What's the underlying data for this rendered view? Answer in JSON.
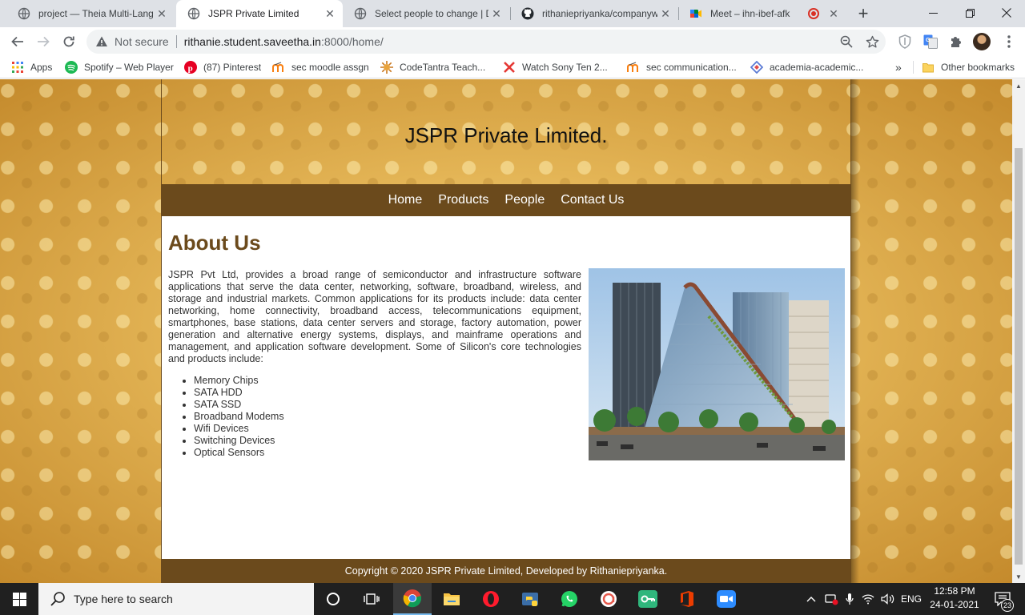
{
  "browser": {
    "tabs": [
      {
        "title": "project — Theia Multi-Lang",
        "icon": "globe-icon",
        "active": false
      },
      {
        "title": "JSPR Private Limited",
        "icon": "globe-icon",
        "active": true
      },
      {
        "title": "Select people to change | D",
        "icon": "globe-icon",
        "active": false
      },
      {
        "title": "rithaniepriyanka/companyw",
        "icon": "github-icon",
        "active": false
      },
      {
        "title": "Meet – ihn-ibef-afk",
        "icon": "meet-icon",
        "active": false
      }
    ],
    "close_glyph": "✕",
    "new_tab_glyph": "+",
    "omnibox": {
      "security_label": "Not secure",
      "url_host": "rithanie.student.saveetha.in",
      "url_path": ":8000/home/"
    },
    "bookmarks": [
      {
        "label": "Apps",
        "icon": "apps-grid-icon"
      },
      {
        "label": "Spotify – Web Player",
        "icon": "spotify-icon"
      },
      {
        "label": "(87) Pinterest",
        "icon": "pinterest-icon"
      },
      {
        "label": "sec moodle assgn",
        "icon": "moodle-icon"
      },
      {
        "label": "CodeTantra Teach...",
        "icon": "codetantra-icon"
      },
      {
        "label": "Watch Sony Ten 2...",
        "icon": "sony-icon"
      },
      {
        "label": "sec communication...",
        "icon": "moodle-icon"
      },
      {
        "label": "academia-academic...",
        "icon": "academia-icon"
      }
    ],
    "bookmarks_overflow": "»",
    "other_bookmarks": "Other bookmarks"
  },
  "site": {
    "title": "JSPR Private Limited.",
    "nav": [
      "Home",
      "Products",
      "People",
      "Contact Us"
    ],
    "about_heading": "About Us",
    "about_text": "JSPR Pvt Ltd, provides a broad range of semiconductor and infrastructure software applications that serve the data center, networking, software, broadband, wireless, and storage and industrial markets. Common applications for its products include: data center networking, home connectivity, broadband access, telecommunications equipment, smartphones, base stations, data center servers and storage, factory automation, power generation and alternative energy systems, displays, and mainframe operations and management, and application software development. Some of Silicon's core technologies and products include:",
    "products": [
      "Memory Chips",
      "SATA HDD",
      "SATA SSD",
      "Broadband Modems",
      "Wifi Devices",
      "Switching Devices",
      "Optical Sensors"
    ],
    "footer": "Copyright © 2020 JSPR Private Limited, Developed by Rithaniepriyanka."
  },
  "taskbar": {
    "search_placeholder": "Type here to search",
    "language": "ENG",
    "time": "12:58 PM",
    "date": "24-01-2021",
    "notification_count": "23"
  },
  "colors": {
    "brand_brown": "#6b4a1c",
    "gold_background": "#e3b455"
  }
}
